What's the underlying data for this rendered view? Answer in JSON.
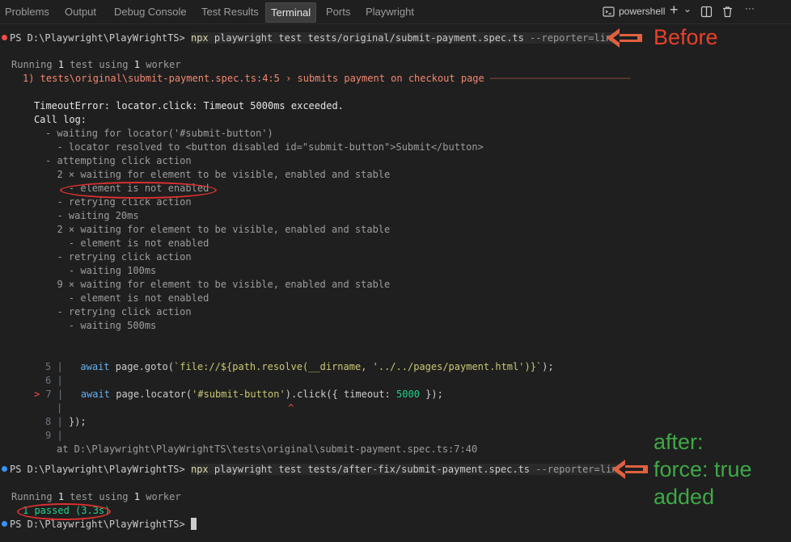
{
  "panel": {
    "tabs": [
      "Problems",
      "Output",
      "Debug Console",
      "Test Results",
      "Terminal",
      "Ports",
      "Playwright"
    ],
    "active_tab": "Terminal",
    "shell_label": "powershell",
    "plus_glyph": "+",
    "chevron_glyph": "⌄",
    "more_glyph": "···"
  },
  "terminal": {
    "prompt1": "PS D:\\Playwright\\PlayWrightTS>",
    "cmd1_npx": "npx",
    "cmd1_args": "playwright test tests/original/submit-payment.spec.ts",
    "cmd1_flag": "--reporter=line",
    "running1_a": "Running",
    "running1_n1": "1",
    "running1_b": "test using",
    "running1_n2": "1",
    "running1_c": "worker",
    "failure_line": "1) tests\\original\\submit-payment.spec.ts:4:5 › submits payment on checkout page",
    "failure_rule": "────────────────────────",
    "timeout_error": "TimeoutError: locator.click: Timeout 5000ms exceeded.",
    "call_log": "Call log:",
    "log_lines": [
      "- waiting for locator('#submit-button')",
      "  - locator resolved to <button disabled id=\"submit-button\">Submit</button>",
      "- attempting click action",
      "  2 × waiting for element to be visible, enabled and stable",
      "    - element is not enabled",
      "  - retrying click action",
      "  - waiting 20ms",
      "  2 × waiting for element to be visible, enabled and stable",
      "    - element is not enabled",
      "  - retrying click action",
      "    - waiting 100ms",
      "  9 × waiting for element to be visible, enabled and stable",
      "    - element is not enabled",
      "  - retrying click action",
      "    - waiting 500ms"
    ],
    "code": {
      "l5_num": "5",
      "l5_kw": "await",
      "l5_a": "page.goto(",
      "l5_str": "`file://${path.resolve(__dirname, '../../pages/payment.html')}`",
      "l5_b": ");",
      "l6_num": "6",
      "l7_marker": ">",
      "l7_num": "7",
      "l7_kw": "await",
      "l7_a": "page.locator(",
      "l7_str": "'#submit-button'",
      "l7_b": ").click({ timeout:",
      "l7_val": "5000",
      "l7_c": "});",
      "caret": "^",
      "l8_num": "8",
      "l8_code": "});",
      "l9_num": "9",
      "at_line": "at D:\\Playwright\\PlayWrightTS\\tests\\original\\submit-payment.spec.ts:7:40",
      "pipe": "|"
    },
    "prompt2": "PS D:\\Playwright\\PlayWrightTS>",
    "cmd2_npx": "npx",
    "cmd2_args": "playwright test tests/after-fix/submit-payment.spec.ts",
    "cmd2_flag": "--reporter=line",
    "running2_a": "Running",
    "running2_n1": "1",
    "running2_b": "test using",
    "running2_n2": "1",
    "running2_c": "worker",
    "passed": "1 passed (3.3s)",
    "prompt3": "PS D:\\Playwright\\PlayWrightTS>"
  },
  "annotations": {
    "before": "Before",
    "after_lines": [
      "after:",
      "force: true",
      "added"
    ],
    "colors": {
      "before": "#e8402a",
      "after": "#3ea845",
      "arrow": "#e0603f",
      "oval": "#e03030"
    }
  }
}
